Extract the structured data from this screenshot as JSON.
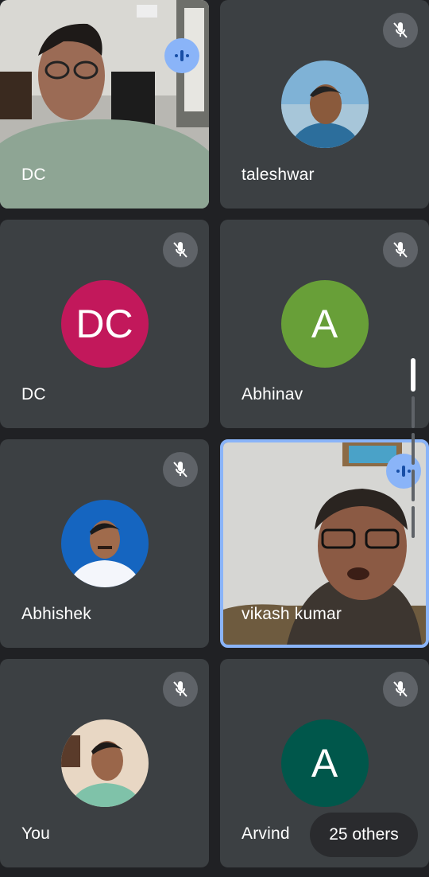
{
  "participants": [
    {
      "name": "DC",
      "kind": "video",
      "status": "speaking"
    },
    {
      "name": "taleshwar",
      "kind": "photo",
      "status": "muted"
    },
    {
      "name": "DC",
      "kind": "initials",
      "initials": "DC",
      "avatar_color": "#c2185b",
      "status": "muted"
    },
    {
      "name": "Abhinav",
      "kind": "initials",
      "initials": "A",
      "avatar_color": "#689f38",
      "status": "muted"
    },
    {
      "name": "Abhishek",
      "kind": "photo",
      "status": "muted"
    },
    {
      "name": "vikash kumar",
      "kind": "video",
      "status": "speaking"
    },
    {
      "name": "You",
      "kind": "photo",
      "status": "muted"
    },
    {
      "name": "Arvind",
      "kind": "initials",
      "initials": "A",
      "avatar_color": "#00574b",
      "status": "muted"
    }
  ],
  "others_label": "25 others",
  "icons": {
    "muted": "mic-off-icon",
    "speaking": "audio-level-icon"
  },
  "colors": {
    "tile": "#3c4043",
    "background": "#202124",
    "active_border": "#8ab4f8",
    "mute_bg": "#5f6368"
  }
}
